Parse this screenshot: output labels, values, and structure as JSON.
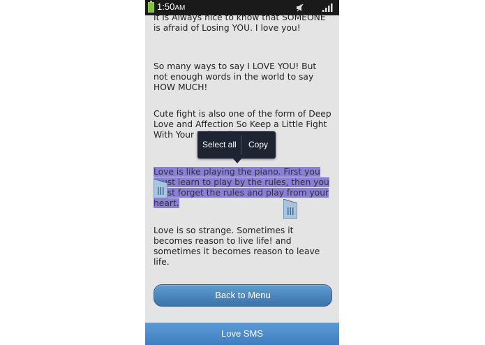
{
  "status_bar": {
    "time": "1:50",
    "ampm": "AM",
    "battery_color": "#7cc142",
    "icons": [
      "battery-icon",
      "mute-icon",
      "signal-icon"
    ]
  },
  "messages": [
    "It is Always nice to know that SOMEONE is afraid of Losing YOU. I love you!",
    "So many ways to say I LOVE YOU! But not enough words in the world to say HOW MUCH!",
    "Cute fight is also one of the form of Deep Love and Affection So Keep a Little Fight With Your Beloved One.",
    "Love is like playing the piano. First you must learn to play by the rules, then you must forget the rules and play from your heart.",
    "Love is so strange. Sometimes it becomes reason to live life! and sometimes it becomes reason to leave life."
  ],
  "selected_message_index": 3,
  "selection_color": "#8a7fd6",
  "context_menu": {
    "items": [
      "Select all",
      "Copy"
    ]
  },
  "back_button_label": "Back to Menu",
  "bottom_bar_title": "Love SMS",
  "colors": {
    "accent": "#3f7ec0",
    "background": "#e4e4e4",
    "popup": "#1f2433"
  }
}
